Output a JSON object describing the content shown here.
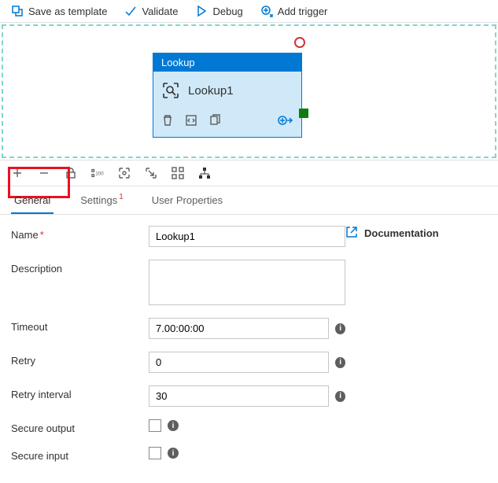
{
  "toolbar": {
    "save_template": "Save as template",
    "validate": "Validate",
    "debug": "Debug",
    "add_trigger": "Add trigger"
  },
  "activity": {
    "header": "Lookup",
    "title": "Lookup1"
  },
  "tabs": {
    "general": "General",
    "settings": "Settings",
    "settings_badge": "1",
    "user_properties": "User Properties"
  },
  "form": {
    "name_label": "Name",
    "name_value": "Lookup1",
    "description_label": "Description",
    "description_value": "",
    "timeout_label": "Timeout",
    "timeout_value": "7.00:00:00",
    "retry_label": "Retry",
    "retry_value": "0",
    "retry_interval_label": "Retry interval",
    "retry_interval_value": "30",
    "secure_output_label": "Secure output",
    "secure_input_label": "Secure input"
  },
  "documentation": "Documentation"
}
